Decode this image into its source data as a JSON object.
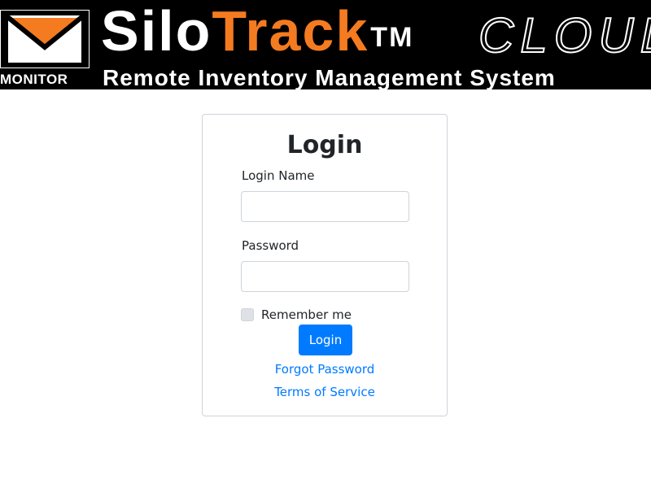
{
  "header": {
    "logo_icon": "monitor-envelope-logo",
    "logo_subtext": "MONITOR",
    "brand_silo": "Silo",
    "brand_track": "Track",
    "brand_tm": "TM",
    "brand_cloud": "CLOUD",
    "tagline": "Remote Inventory Management System",
    "colors": {
      "background": "#000000",
      "accent": "#f47b20",
      "text": "#ffffff"
    }
  },
  "login_form": {
    "title": "Login",
    "login_name_label": "Login Name",
    "login_name_value": "",
    "login_name_placeholder": "",
    "password_label": "Password",
    "password_value": "",
    "password_placeholder": "",
    "remember_label": "Remember me",
    "remember_checked": false,
    "submit_label": "Login",
    "forgot_password_link": "Forgot Password",
    "terms_link": "Terms of Service",
    "colors": {
      "primary": "#007bff",
      "border": "#cfd4d9"
    }
  }
}
